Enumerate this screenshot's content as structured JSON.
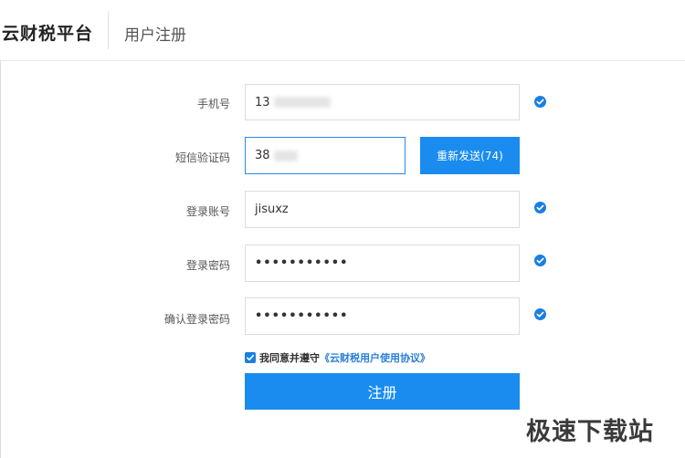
{
  "header": {
    "brand": "云财税平台",
    "page_title": "用户注册"
  },
  "form": {
    "phone": {
      "label": "手机号",
      "value_visible": "13"
    },
    "sms_code": {
      "label": "短信验证码",
      "value_visible": "38",
      "resend_label": "重新发送(74)"
    },
    "account": {
      "label": "登录账号",
      "value": "jisuxz"
    },
    "password": {
      "label": "登录密码",
      "value_masked": "•••••••••••"
    },
    "confirm_password": {
      "label": "确认登录密码",
      "value_masked": "•••••••••••"
    },
    "agreement": {
      "prefix": "我同意并遵守",
      "link_text": "《云财税用户使用协议》",
      "checked": true
    },
    "submit_label": "注册"
  },
  "watermark": "极速下载站",
  "colors": {
    "primary": "#1a8cf0",
    "check": "#1a7fe0",
    "link": "#2a7fd8"
  },
  "icons": {
    "valid": "check-circle-icon",
    "checkbox": "checkbox-checked-icon"
  }
}
